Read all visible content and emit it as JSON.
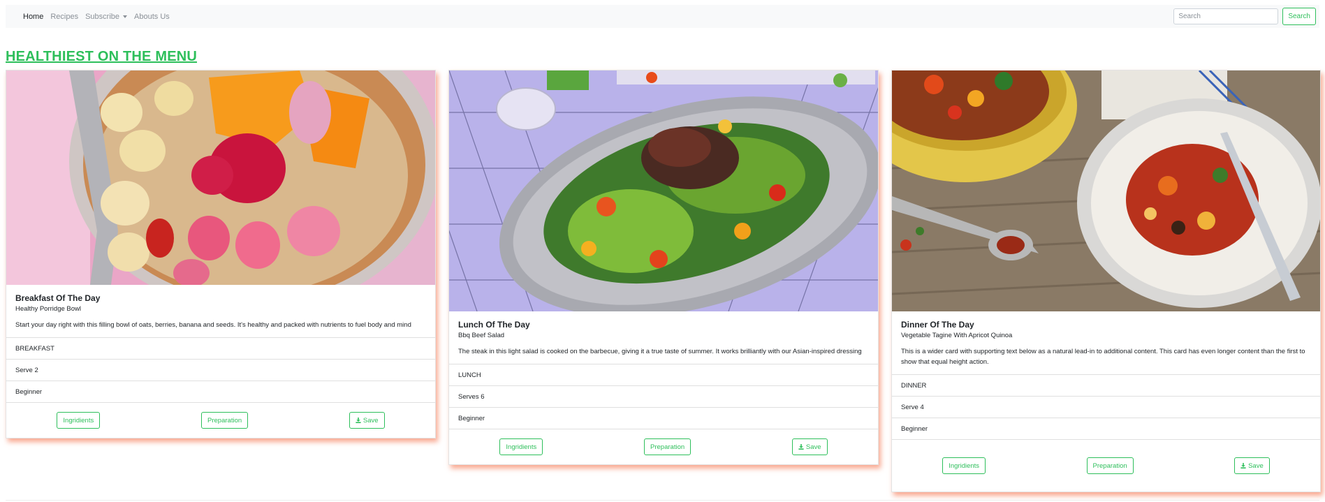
{
  "nav": {
    "items": [
      {
        "label": "Home",
        "active": true
      },
      {
        "label": "Recipes",
        "active": false
      },
      {
        "label": "Subscribe",
        "active": false,
        "dropdown": true
      },
      {
        "label": "Abouts Us",
        "active": false
      }
    ],
    "search_placeholder": "Search",
    "search_button": "Search"
  },
  "heading": "HEALTHIEST ON THE MENU",
  "cards": [
    {
      "title": "Breakfast Of The Day",
      "subtitle": "Healthy Porridge Bowl",
      "text": "Start your day right with this filling bowl of oats, berries, banana and seeds. It's healthy and packed with nutrients to fuel body and mind",
      "items": [
        "BREAKFAST",
        "Serve 2",
        "Beginner"
      ],
      "buttons": {
        "ingredients": "Ingridients",
        "preparation": "Preparation",
        "save": "Save"
      }
    },
    {
      "title": "Lunch Of The Day",
      "subtitle": "Bbq Beef Salad",
      "text": "The steak in this light salad is cooked on the barbecue, giving it a true taste of summer. It works brilliantly with our Asian-inspired dressing",
      "items": [
        "LUNCH",
        "Serves 6",
        "Beginner"
      ],
      "buttons": {
        "ingredients": "Ingridients",
        "preparation": "Preparation",
        "save": "Save"
      }
    },
    {
      "title": "Dinner Of The Day",
      "subtitle": "Vegetable Tagine With Apricot Quinoa",
      "text": "This is a wider card with supporting text below as a natural lead-in to additional content. This card has even longer content than the first to show that equal height action.",
      "items": [
        "DINNER",
        "Serve 4",
        "Beginner"
      ],
      "buttons": {
        "ingredients": "Ingridients",
        "preparation": "Preparation",
        "save": "Save"
      }
    }
  ],
  "colors": {
    "accent": "#2ebf5b",
    "card_shadow": "#f56e46",
    "navbar_bg": "#f8f9fa"
  },
  "icons": {
    "save": "download-icon",
    "dropdown": "caret-down-icon"
  }
}
